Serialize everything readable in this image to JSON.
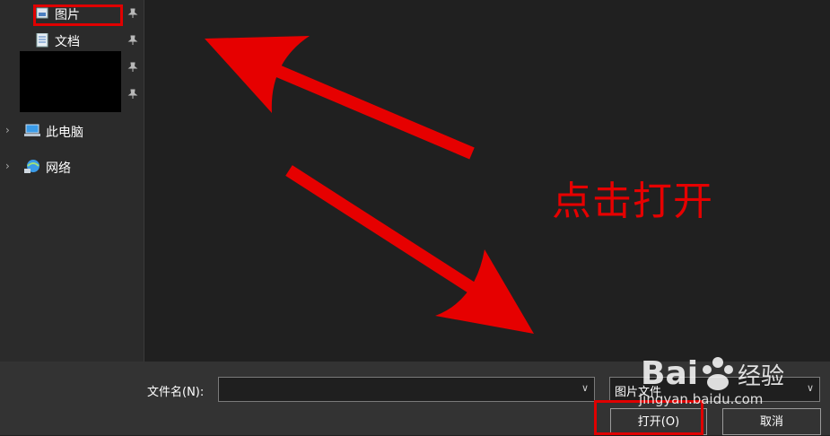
{
  "sidebar": {
    "items": [
      {
        "label": "图片",
        "icon": "picture-icon",
        "pinned": true
      },
      {
        "label": "文档",
        "icon": "document-icon",
        "pinned": true
      },
      {
        "label": "此电脑",
        "icon": "computer-icon"
      },
      {
        "label": "网络",
        "icon": "network-icon"
      }
    ]
  },
  "annotation": {
    "text": "点击打开",
    "color": "#e60000"
  },
  "footer": {
    "filename_label": "文件名(N):",
    "filename_value": "",
    "filetype_value": "图片文件",
    "open_label": "打开(O)",
    "cancel_label": "取消"
  },
  "watermark": {
    "brand": "Bai du 经验",
    "url": "jingyan.baidu.com"
  }
}
